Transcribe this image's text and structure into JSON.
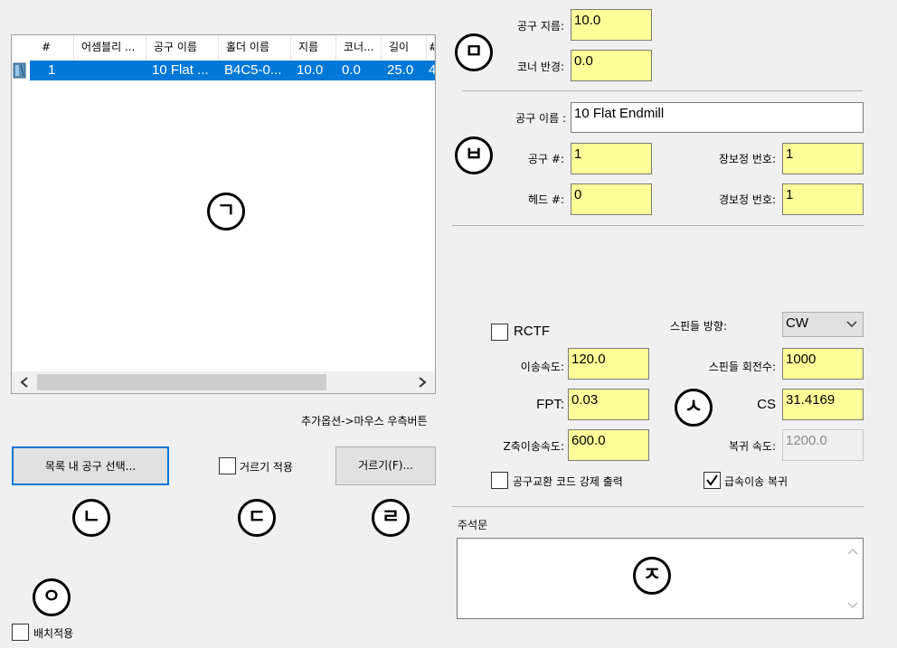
{
  "list": {
    "columns": [
      "#",
      "어셈블리 ...",
      "공구 이름",
      "홀더 이름",
      "지름",
      "코너...",
      "길이",
      "#"
    ],
    "rows": [
      {
        "num": "1",
        "assembly": "",
        "tool_name": "10 Flat ...",
        "holder": "B4C5-0...",
        "diameter": "10.0",
        "corner": "0.0",
        "length": "25.0",
        "extra": "4"
      }
    ],
    "marker": "ㄱ"
  },
  "hint": "추가옵션->마우스 우측버튼",
  "buttons": {
    "select_tool": "목록 내 공구 선택...",
    "filter": "거르기(F)..."
  },
  "filter_apply": {
    "label": "거르기 적용",
    "checked": false
  },
  "batch_apply": {
    "label": "배치적용",
    "checked": false
  },
  "markers": {
    "n": "ㄴ",
    "d": "ㄷ",
    "r": "ㄹ",
    "o": "ㅇ",
    "m": "ㅁ",
    "b": "ㅂ",
    "s": "ㅅ",
    "j": "ㅈ"
  },
  "geometry": {
    "diameter_label": "공구 지름:",
    "diameter_value": "10.0",
    "corner_label": "코너 반경:",
    "corner_value": "0.0"
  },
  "tool": {
    "name_label": "공구 이름 :",
    "name_value": "10 Flat Endmill",
    "number_label": "공구 #:",
    "number_value": "1",
    "head_label": "헤드 #:",
    "head_value": "0",
    "length_offset_label": "장보정 번호:",
    "length_offset_value": "1",
    "dia_offset_label": "경보정 번호:",
    "dia_offset_value": "1"
  },
  "cutting": {
    "rctf_label": "RCTF",
    "rctf_checked": false,
    "spindle_dir_label": "스핀들 방향:",
    "spindle_dir_value": "CW",
    "feed_label": "이송속도:",
    "feed_value": "120.0",
    "rpm_label": "스핀들 회전수:",
    "rpm_value": "1000",
    "fpt_label": "FPT:",
    "fpt_value": "0.03",
    "cs_label": "CS",
    "cs_value": "31.4169",
    "z_feed_label": "Z축이송속도:",
    "z_feed_value": "600.0",
    "retract_label": "복귀 속도:",
    "retract_value": "1200.0",
    "force_toolchange_label": "공구교환 코드 강제 출력",
    "force_toolchange_checked": false,
    "rapid_retract_label": "급속이송 복귀",
    "rapid_retract_checked": true
  },
  "comment": {
    "label": "주석문",
    "value": ""
  },
  "colors": {
    "selection": "#0078d7",
    "field_yellow": "#ffff99"
  }
}
